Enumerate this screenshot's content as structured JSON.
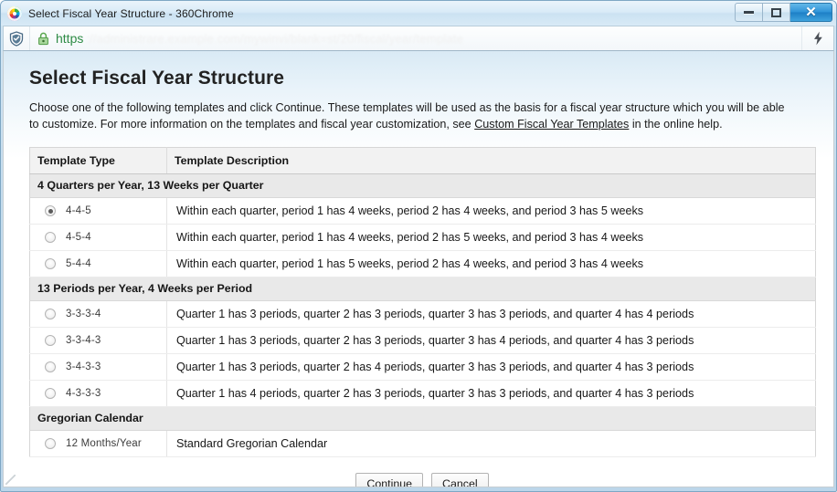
{
  "window": {
    "title": "Select Fiscal Year Structure - 360Chrome",
    "logo_icon": "360-browser-logo-icon",
    "controls": {
      "minimize_label": "–",
      "restore_label": "❐",
      "close_label": "✕"
    }
  },
  "toolbar": {
    "shield_icon": "shield-icon",
    "lock_icon": "lock-icon",
    "url_scheme": "https",
    "url_rest": "://administrare.example.com/mywinvi/blank=st/20/fiscal/year/template",
    "bolt_icon": "lightning-bolt-icon"
  },
  "page": {
    "title": "Select Fiscal Year Structure",
    "description_part1": "Choose one of the following templates and click Continue. These templates will be used as the basis for a fiscal year structure which you will be able to customize. For more information on the templates and fiscal year customization, see ",
    "description_link": "Custom Fiscal Year Templates",
    "description_part2": " in the online help."
  },
  "table": {
    "headers": {
      "type": "Template Type",
      "description": "Template Description"
    },
    "groups": [
      {
        "label": "4 Quarters per Year, 13 Weeks per Quarter",
        "rows": [
          {
            "type": "4-4-5",
            "description": "Within each quarter, period 1 has 4 weeks, period 2 has 4 weeks, and period 3 has 5 weeks",
            "selected": true
          },
          {
            "type": "4-5-4",
            "description": "Within each quarter, period 1 has 4 weeks, period 2 has 5 weeks, and period 3 has 4 weeks",
            "selected": false
          },
          {
            "type": "5-4-4",
            "description": "Within each quarter, period 1 has 5 weeks, period 2 has 4 weeks, and period 3 has 4 weeks",
            "selected": false
          }
        ]
      },
      {
        "label": "13 Periods per Year, 4 Weeks per Period",
        "rows": [
          {
            "type": "3-3-3-4",
            "description": "Quarter 1 has 3 periods, quarter 2 has 3 periods, quarter 3 has 3 periods, and quarter 4 has 4 periods",
            "selected": false
          },
          {
            "type": "3-3-4-3",
            "description": "Quarter 1 has 3 periods, quarter 2 has 3 periods, quarter 3 has 4 periods, and quarter 4 has 3 periods",
            "selected": false
          },
          {
            "type": "3-4-3-3",
            "description": "Quarter 1 has 3 periods, quarter 2 has 4 periods, quarter 3 has 3 periods, and quarter 4 has 3 periods",
            "selected": false
          },
          {
            "type": "4-3-3-3",
            "description": "Quarter 1 has 4 periods, quarter 2 has 3 periods, quarter 3 has 3 periods, and quarter 4 has 3 periods",
            "selected": false
          }
        ]
      },
      {
        "label": "Gregorian Calendar",
        "rows": [
          {
            "type": "12 Months/Year",
            "description": "Standard Gregorian Calendar",
            "selected": false
          }
        ]
      }
    ]
  },
  "buttons": {
    "continue_label": "Continue",
    "cancel_label": "Cancel"
  },
  "colors": {
    "accent": "#2f93d8",
    "link": "#1a1a1a",
    "https_green": "#2e8b45",
    "group_row_bg": "#e9e9e9",
    "header_row_bg": "#f2f2f2"
  }
}
